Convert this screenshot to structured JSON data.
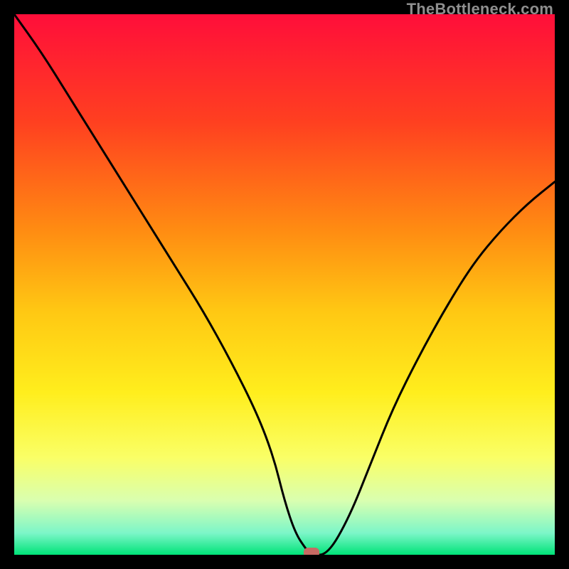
{
  "watermark": "TheBottleneck.com",
  "chart_data": {
    "type": "line",
    "title": "",
    "xlabel": "",
    "ylabel": "",
    "xlim": [
      0,
      100
    ],
    "ylim": [
      0,
      100
    ],
    "gradient_stops": [
      {
        "pct": 0,
        "color": "#ff0e3a"
      },
      {
        "pct": 20,
        "color": "#ff4020"
      },
      {
        "pct": 40,
        "color": "#ff8c12"
      },
      {
        "pct": 55,
        "color": "#ffc813"
      },
      {
        "pct": 70,
        "color": "#ffee1d"
      },
      {
        "pct": 82,
        "color": "#faff66"
      },
      {
        "pct": 90,
        "color": "#d9ffb0"
      },
      {
        "pct": 96,
        "color": "#7cf6c8"
      },
      {
        "pct": 100,
        "color": "#00e378"
      }
    ],
    "curve": {
      "x": [
        0,
        5,
        10,
        15,
        20,
        25,
        30,
        35,
        40,
        45,
        48,
        50,
        52,
        54,
        55,
        58,
        62,
        66,
        70,
        75,
        80,
        85,
        90,
        95,
        100
      ],
      "values": [
        100,
        93,
        85,
        77,
        69,
        61,
        53,
        45,
        36,
        26,
        18,
        10,
        4,
        1,
        0,
        0,
        7,
        17,
        27,
        37,
        46,
        54,
        60,
        65,
        69
      ]
    },
    "marker": {
      "x": 55,
      "y": 0,
      "color": "#c76a63"
    }
  }
}
